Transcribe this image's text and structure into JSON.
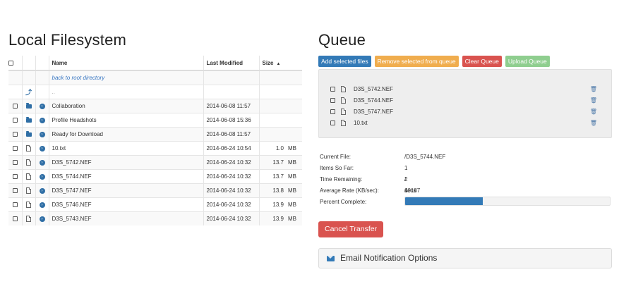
{
  "left": {
    "title": "Local Filesystem",
    "table": {
      "headers": {
        "name": "Name",
        "modified": "Last Modified",
        "size": "Size"
      },
      "sort_indicator": "▲",
      "back_link": "back to root directory",
      "parent_dots": "..",
      "rows": [
        {
          "type": "folder",
          "name": "Collaboration",
          "modified": "2014-06-08 11:57",
          "size": "",
          "unit": ""
        },
        {
          "type": "folder",
          "name": "Profile Headshots",
          "modified": "2014-06-08 15:36",
          "size": "",
          "unit": ""
        },
        {
          "type": "folder",
          "name": "Ready for Download",
          "modified": "2014-06-08 11:57",
          "size": "",
          "unit": ""
        },
        {
          "type": "file",
          "name": "10.txt",
          "modified": "2014-06-24 10:54",
          "size": "1.0",
          "unit": "MB"
        },
        {
          "type": "file",
          "name": "D3S_5742.NEF",
          "modified": "2014-06-24 10:32",
          "size": "13.7",
          "unit": "MB"
        },
        {
          "type": "file",
          "name": "D3S_5744.NEF",
          "modified": "2014-06-24 10:32",
          "size": "13.7",
          "unit": "MB"
        },
        {
          "type": "file",
          "name": "D3S_5747.NEF",
          "modified": "2014-06-24 10:32",
          "size": "13.8",
          "unit": "MB"
        },
        {
          "type": "file",
          "name": "D3S_5746.NEF",
          "modified": "2014-06-24 10:32",
          "size": "13.9",
          "unit": "MB"
        },
        {
          "type": "file",
          "name": "D3S_5743.NEF",
          "modified": "2014-06-24 10:32",
          "size": "13.9",
          "unit": "MB"
        }
      ]
    }
  },
  "queue": {
    "title": "Queue",
    "buttons": {
      "add": "Add selected files",
      "remove": "Remove selected from queue",
      "clear": "Clear Queue",
      "upload": "Upload Queue"
    },
    "items": [
      "D3S_5742.NEF",
      "D3S_5744.NEF",
      "D3S_5747.NEF",
      "10.txt"
    ],
    "stats": {
      "current_file_label": "Current File:",
      "current_file": "/D3S_5744.NEF",
      "items_label": "Items So Far:",
      "items": "1 / 4",
      "remaining_label": "Time Remaining:",
      "remaining": "2 secs",
      "rate_label": "Average Rate (KB/sec):",
      "rate": "10187",
      "percent_label": "Percent Complete:"
    },
    "progress_fraction": 0.38,
    "cancel_label": "Cancel Transfer",
    "email_label": "Email Notification Options"
  },
  "colors": {
    "primary": "#337ab7",
    "warning": "#f0ad4e",
    "danger": "#d9534f",
    "success_light": "#8fce8f"
  }
}
